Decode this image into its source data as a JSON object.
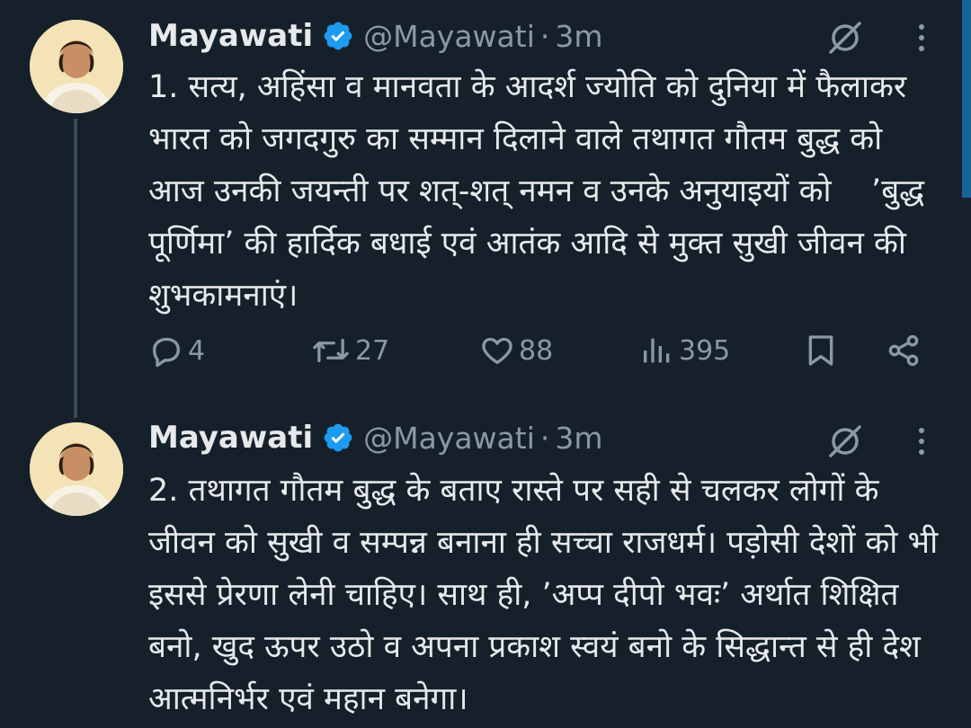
{
  "tweets": [
    {
      "author": {
        "name": "Mayawati",
        "handle": "@Mayawati",
        "separator": "·",
        "time": "3m"
      },
      "text": "1. सत्य, अहिंसा व मानवता के आदर्श ज्योति को दुनिया में फैलाकर भारत को जगदगुरु का सम्मान दिलाने वाले तथागत गौतम बुद्ध को आज उनकी जयन्ती पर शत्-शत् नमन व उनके अनुयाइयों को    ’बुद्ध पूर्णिमा’ की हार्दिक बधाई एवं आतंक आदि से मुक्त सुखी जीवन की शुभकामनाएं।",
      "stats": {
        "replies": "4",
        "retweets": "27",
        "likes": "88",
        "views": "395"
      }
    },
    {
      "author": {
        "name": "Mayawati",
        "handle": "@Mayawati",
        "separator": "·",
        "time": "3m"
      },
      "text": "2. तथागत गौतम बुद्ध के बताए रास्ते पर सही से चलकर लोगों के जीवन को सुखी व सम्पन्न बनाना ही सच्चा राजधर्म। पड़ोसी देशों को भी इससे प्रेरणा लेनी चाहिए। साथ ही, ’अप्प दीपो भवः’ अर्थात शिक्षित बनो, खुद ऊपर उठो व अपना प्रकाश स्वयं बनो के सिद्धान्त से ही देश आत्मनिर्भर एवं महान बनेगा।"
    }
  ],
  "icons": {
    "verified": "verified-badge-icon",
    "grok": "grok-icon",
    "more": "more-vertical-icon",
    "reply": "reply-icon",
    "retweet": "retweet-icon",
    "like": "heart-icon",
    "views": "views-chart-icon",
    "bookmark": "bookmark-icon",
    "share": "share-icon"
  },
  "colors": {
    "background": "#15202b",
    "text": "#e7e9ea",
    "muted": "#8b98a5",
    "verified": "#1d9bf0",
    "thread_line": "#3a4a58"
  }
}
